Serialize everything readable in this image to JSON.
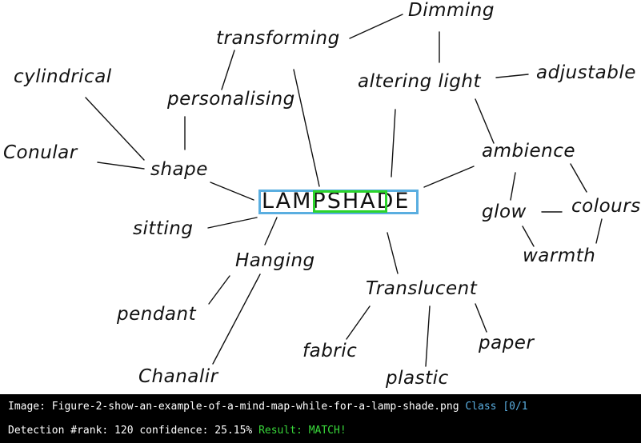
{
  "mindmap": {
    "center": "LAMPSHADE",
    "words": {
      "dimming": "Dimming",
      "transforming": "transforming",
      "cylindrical": "cylindrical",
      "personalising": "personalising",
      "altering_light": "altering light",
      "adjustable": "adjustable",
      "conular": "Conular",
      "shape": "shape",
      "ambience": "ambience",
      "glow": "glow",
      "colours": "colours",
      "sitting": "sitting",
      "warmth": "warmth",
      "hanging": "Hanging",
      "translucent": "Translucent",
      "pendant": "pendant",
      "fabric": "fabric",
      "paper": "paper",
      "chanalir": "Chanalir",
      "plastic": "plastic"
    },
    "colors": {
      "outer_box": "#5aaee0",
      "inner_box": "#2bd42b"
    }
  },
  "status": {
    "line1": {
      "label": "Image: ",
      "filename": "Figure-2-show-an-example-of-a-mind-map-while-for-a-lamp-shade.png",
      "class_text": " Class [0/1"
    },
    "line2": {
      "prefix": "Detection #rank: 120 confidence: 25.15%",
      "result": " Result: MATCH!"
    },
    "colors": {
      "background": "#000000",
      "text": "#ffffff",
      "accent": "#5aaee0",
      "match": "#39d83a"
    }
  }
}
